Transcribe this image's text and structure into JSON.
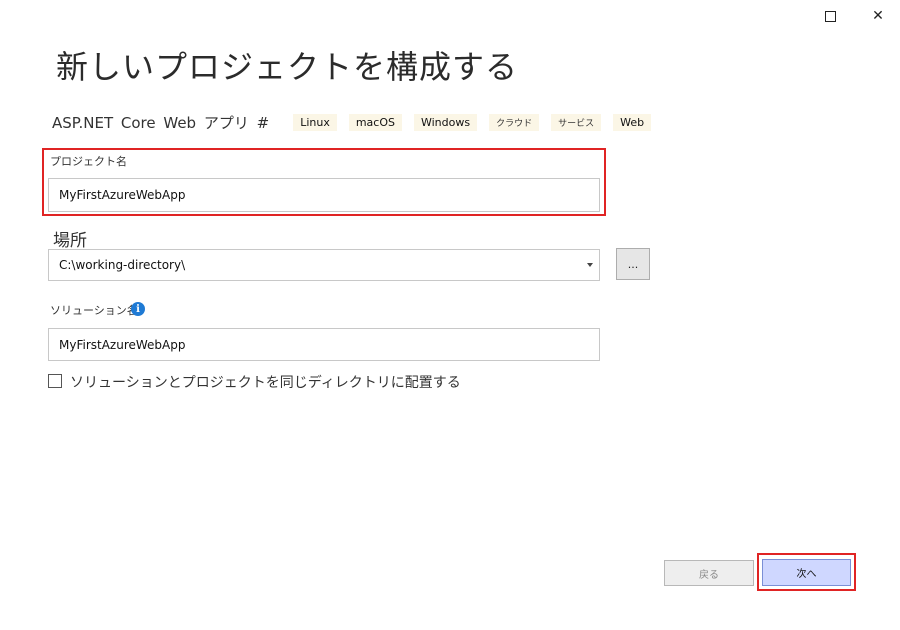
{
  "window": {
    "maximize_icon": "maximize-icon",
    "close_icon": "close-icon",
    "close_glyph": "✕"
  },
  "page": {
    "title": "新しいプロジェクトを構成する"
  },
  "template": {
    "name": "ASP.NET Core Web アプリ #",
    "tags": [
      "Linux",
      "macOS",
      "Windows",
      "クラウド",
      "サービス",
      "Web"
    ]
  },
  "form": {
    "project_name_label": "プロジェクト名",
    "project_name_value": "MyFirstAzureWebApp",
    "location_label": "場所",
    "location_value": "C:\\working-directory\\",
    "browse_label": "...",
    "solution_name_label": "ソリューション名",
    "solution_name_value": "MyFirstAzureWebApp",
    "info_glyph": "i",
    "same_dir_label": "ソリューションとプロジェクトを同じディレクトリに配置する",
    "same_dir_checked": false
  },
  "buttons": {
    "back_label": "戻る",
    "next_label": "次へ"
  },
  "colors": {
    "highlight": "#e02424",
    "tag_bg": "#fbf6e6",
    "info": "#1f7ad4",
    "next_bg": "#cfd7ff"
  }
}
